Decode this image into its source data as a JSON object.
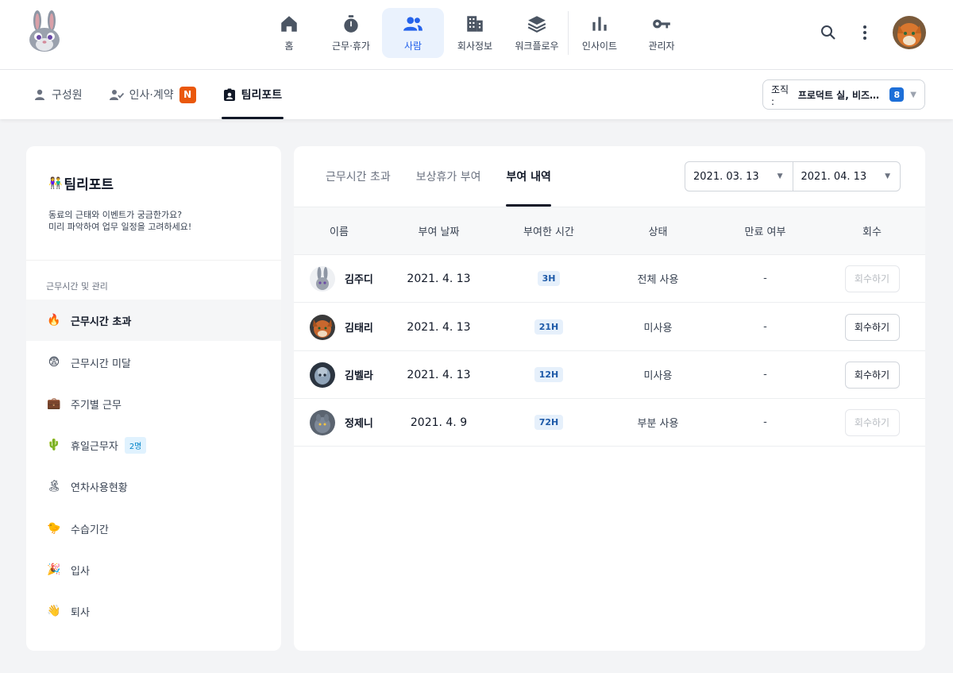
{
  "topnav": {
    "items": [
      {
        "label": "홈",
        "icon": "home-icon"
      },
      {
        "label": "근무·휴가",
        "icon": "stopwatch-icon"
      },
      {
        "label": "사람",
        "icon": "people-icon",
        "active": true
      },
      {
        "label": "회사정보",
        "icon": "building-icon"
      },
      {
        "label": "워크플로우",
        "icon": "layers-icon"
      },
      {
        "label": "인사이트",
        "icon": "bar-chart-icon"
      },
      {
        "label": "관리자",
        "icon": "key-icon"
      }
    ],
    "accent_color": "#2563eb"
  },
  "subnav": {
    "tabs": [
      {
        "label": "구성원"
      },
      {
        "label": "인사·계약",
        "badge": "N"
      },
      {
        "label": "팀리포트",
        "active": true
      }
    ],
    "org": {
      "label": "조직 :",
      "value": "프로덕트 실, 비즈…",
      "count": "8"
    }
  },
  "sidebar": {
    "title": "팀리포트",
    "desc_line1": "동료의 근태와 이벤트가 궁금한가요?",
    "desc_line2": "미리 파악하여 업무 일정을 고려하세요!",
    "section": "근무시간 및 관리",
    "items": [
      {
        "emoji": "🔥",
        "label": "근무시간 초과",
        "active": true
      },
      {
        "emoji": "😨",
        "label": "근무시간 미달"
      },
      {
        "emoji": "💼",
        "label": "주기별 근무"
      },
      {
        "emoji": "🌵",
        "label": "휴일근무자",
        "badge": "2명"
      },
      {
        "emoji": "🏝",
        "label": "연차사용현황"
      },
      {
        "emoji": "🐤",
        "label": "수습기간"
      },
      {
        "emoji": "🎉",
        "label": "입사"
      },
      {
        "emoji": "👋",
        "label": "퇴사"
      }
    ]
  },
  "panel": {
    "tabs": [
      {
        "label": "근무시간 초과"
      },
      {
        "label": "보상휴가 부여"
      },
      {
        "label": "부여 내역",
        "active": true
      }
    ],
    "date_from": "2021. 03. 13",
    "date_to": "2021. 04. 13",
    "columns": [
      "이름",
      "부여 날짜",
      "부여한 시간",
      "상태",
      "만료 여부",
      "회수"
    ],
    "rows": [
      {
        "name": "김주디",
        "date": "2021. 4. 13",
        "hours": "3H",
        "status": "전체 사용",
        "expired": "-",
        "action": "회수하기",
        "disabled": true
      },
      {
        "name": "김태리",
        "date": "2021. 4. 13",
        "hours": "21H",
        "status": "미사용",
        "expired": "-",
        "action": "회수하기",
        "disabled": false
      },
      {
        "name": "김벨라",
        "date": "2021. 4. 13",
        "hours": "12H",
        "status": "미사용",
        "expired": "-",
        "action": "회수하기",
        "disabled": false
      },
      {
        "name": "정제니",
        "date": "2021. 4. 9",
        "hours": "72H",
        "status": "부분 사용",
        "expired": "-",
        "action": "회수하기",
        "disabled": true
      }
    ]
  }
}
